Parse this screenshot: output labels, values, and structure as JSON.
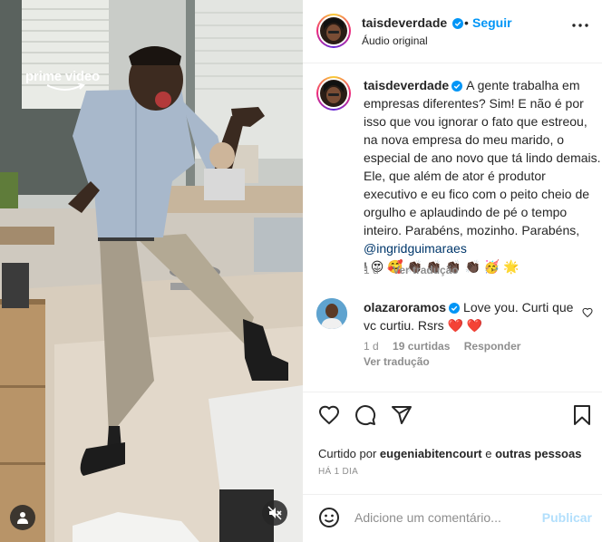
{
  "post": {
    "watermark": "prime video"
  },
  "header": {
    "username": "taisdeverdade",
    "dot": "•",
    "follow_label": "Seguir",
    "audio_label": "Áudio original"
  },
  "caption": {
    "username": "taisdeverdade",
    "text": "A gente trabalha em empresas diferentes? Sim! E não é por isso que vou ignorar o fato que estreou, na nova empresa do meu marido, o especial de ano novo que tá lindo demais. Ele, que além de ator é produtor executivo e eu fico com o peito cheio de orgulho e aplaudindo de pé o tempo inteiro. Parabéns, mozinho. Parabéns, ",
    "mention": "@ingridguimaraes",
    "emojis": "! 😍 🥰 👏🏿 👏🏿 👏🏿 👏🏿 🥳 🌟",
    "age": "1 d",
    "translate_label": "Ver tradução"
  },
  "comment": {
    "username": "olazaroramos",
    "text": "Love you. Curti que vc curtiu. Rsrs",
    "hearts": "❤️ ❤️",
    "age": "1 d",
    "likes": "19 curtidas",
    "reply_label": "Responder",
    "translate_label": "Ver tradução"
  },
  "actions": {
    "icons": [
      "heart-icon",
      "comment-icon",
      "share-icon",
      "bookmark-icon"
    ],
    "liked_by_prefix": "Curtido por ",
    "liked_by_user": "eugeniabitencourt",
    "liked_by_joiner": " e ",
    "liked_by_others": "outras pessoas",
    "timestamp": "HÁ 1 DIA"
  },
  "composer": {
    "placeholder": "Adicione um comentário...",
    "publish_label": "Publicar"
  },
  "colors": {
    "accent": "#0095f6",
    "publish_disabled": "#b2dffc",
    "verified": "#0095f6",
    "like_red": "#ed4956"
  }
}
